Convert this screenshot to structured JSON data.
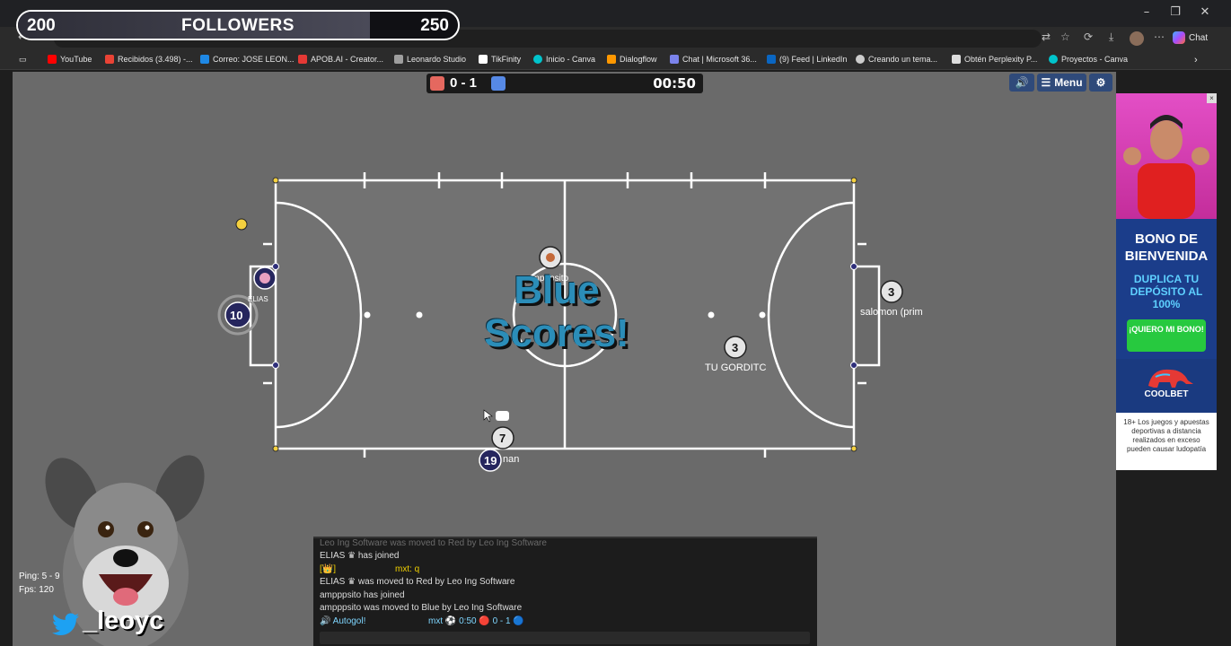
{
  "followers": {
    "current": "200",
    "label": "FOLLOWERS",
    "goal": "250",
    "progress": 0.8
  },
  "browser": {
    "chat_label": "Chat",
    "bookmarks": [
      {
        "label": "YouTube",
        "color": "#ff0000"
      },
      {
        "label": "Recibidos (3.498) -...",
        "color": "#ea4335"
      },
      {
        "label": "Correo: JOSE LEON...",
        "color": "#1e88e5"
      },
      {
        "label": "APOB.AI - Creator...",
        "color": "#e53935"
      },
      {
        "label": "Leonardo Studio",
        "color": "#9e9e9e"
      },
      {
        "label": "TikFinity",
        "color": "#ffffff"
      },
      {
        "label": "Inicio - Canva",
        "color": "#00c4cc"
      },
      {
        "label": "Dialogflow",
        "color": "#ff9800"
      },
      {
        "label": "Chat | Microsoft 36...",
        "color": "#7b83eb"
      },
      {
        "label": "(9) Feed | LinkedIn",
        "color": "#0a66c2"
      },
      {
        "label": "Creando un tema...",
        "color": "#cccccc"
      },
      {
        "label": "Obtén Perplexity P...",
        "color": "#dddddd"
      },
      {
        "label": "Proyectos - Canva",
        "color": "#00c4cc"
      }
    ]
  },
  "game": {
    "score": "0 - 1",
    "timer": "00:50",
    "menu_label": "Menu",
    "scores_banner_line1": "Blue",
    "scores_banner_line2": "Scores!",
    "red_color": "#e5685f",
    "blue_color": "#5689e5",
    "players": {
      "p10": "10",
      "p19": "19",
      "p7": "7",
      "p3a": "3",
      "p3b": "3",
      "name_amp": "ampppsito",
      "name_elias": "ELIAS",
      "name_salomon": "salomon (prim",
      "name_gordito": "TU GORDITC",
      "name_partial": "nan"
    }
  },
  "chat": {
    "lines": [
      {
        "a": "Leo Ing Software was moved to Red by Leo Ing Software"
      },
      {
        "a": "ELIAS ♛ has joined"
      },
      {
        "a": "[👑]",
        "b": "mxt: q"
      },
      {
        "a": "ELIAS ♛ was moved to Red by Leo Ing Software"
      },
      {
        "a": "ampppsito has joined"
      },
      {
        "a": "ampppsito was moved to Blue by Leo Ing Software"
      },
      {
        "a": "🔊 Autogol!",
        "b": "mxt ⚽ 0:50 🔴 0 - 1 🔵"
      }
    ],
    "ping": "Ping: 5 - 9",
    "fps": "Fps: 120"
  },
  "ad": {
    "title1": "BONO DE",
    "title2": "BIENVENIDA",
    "sub1": "DUPLICA TU",
    "sub2": "DEPÓSITO AL",
    "sub3": "100%",
    "cta": "¡QUIERO MI BONO!",
    "brand": "COOLBET",
    "disclaimer": "18+ Los juegos y apuestas deportivas a distancia realizados en exceso pueden causar ludopatía"
  },
  "streamer": {
    "handle": "_leoyc"
  }
}
